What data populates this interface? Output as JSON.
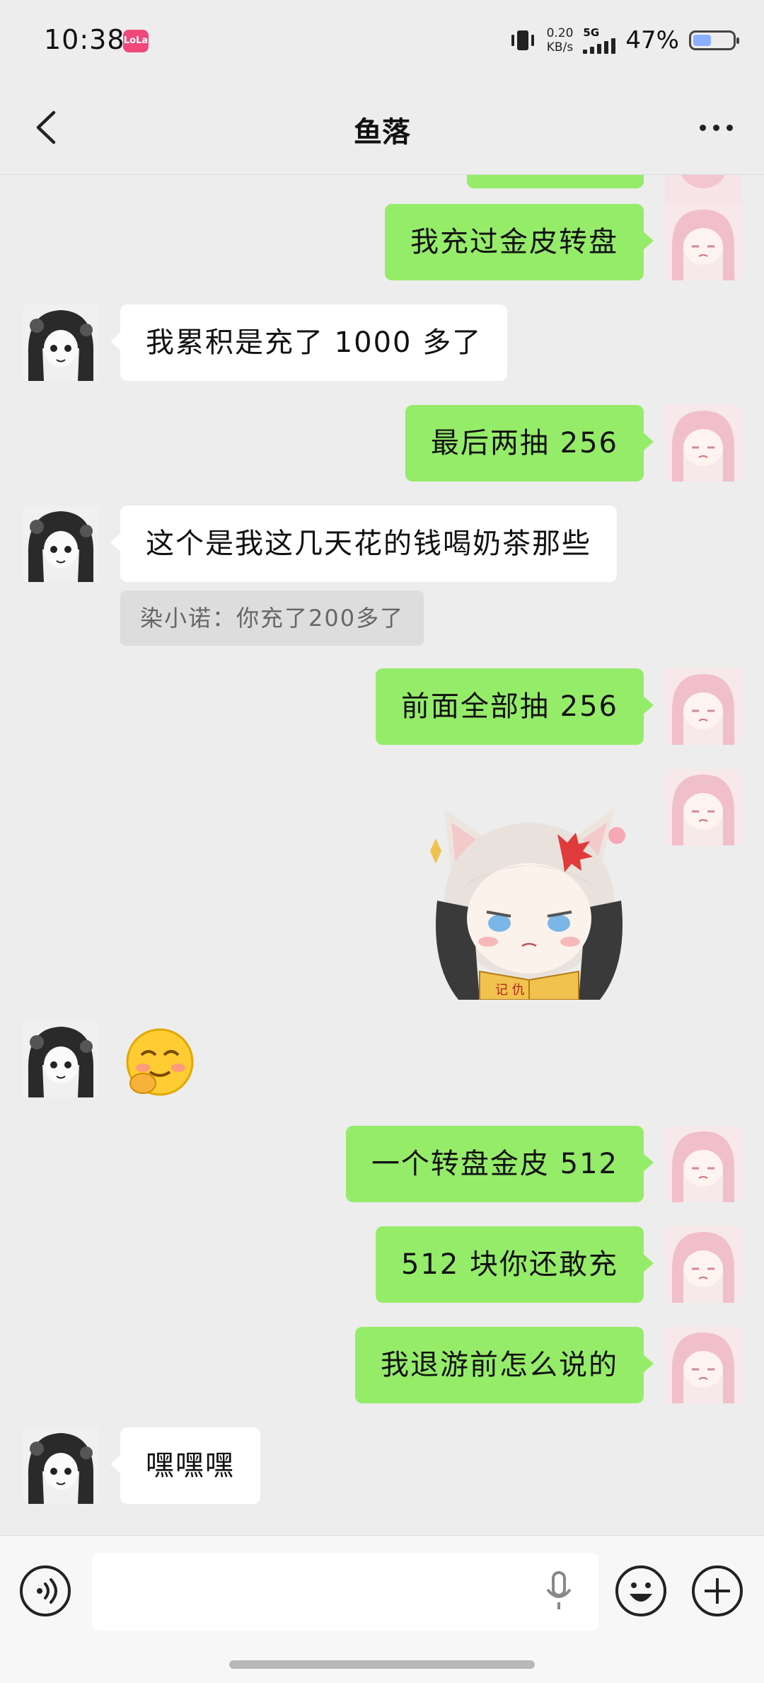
{
  "status_bar": {
    "time": "10:38",
    "app_badge": "LoLa",
    "net_speed": "0.20",
    "net_unit": "KB/s",
    "net_type": "5G",
    "battery_percent": "47%",
    "battery_level": 0.47
  },
  "header": {
    "title": "鱼落",
    "back_icon": "chevron-left-icon",
    "more_icon": "more-dots-icon"
  },
  "messages": [
    {
      "from": "me",
      "text": "我充过金皮转盘"
    },
    {
      "from": "them",
      "text": "我累积是充了 1000 多了"
    },
    {
      "from": "me",
      "text": "最后两抽 256"
    },
    {
      "from": "them",
      "text": "这个是我这几天花的钱喝奶茶那些"
    },
    {
      "from": "them",
      "quote": "染小诺：你充了200多了"
    },
    {
      "from": "me",
      "text": "前面全部抽 256"
    },
    {
      "from": "me",
      "sticker": "sticker-catgirl-angry-notebook",
      "sticker_text": "记 仇"
    },
    {
      "from": "them",
      "emoji": "blushing-smile-emoji"
    },
    {
      "from": "me",
      "text": "一个转盘金皮 512"
    },
    {
      "from": "me",
      "text": "512 块你还敢充"
    },
    {
      "from": "me",
      "text": "我退游前怎么说的"
    },
    {
      "from": "them",
      "text": "嘿嘿嘿"
    }
  ],
  "input_bar": {
    "voice_icon": "voice-icon",
    "mic_icon": "mic-icon",
    "emoji_icon": "emoji-icon",
    "plus_icon": "plus-icon",
    "draft_text": ""
  },
  "colors": {
    "my_bubble": "#95ec69",
    "their_bubble": "#ffffff",
    "background": "#ededed"
  }
}
